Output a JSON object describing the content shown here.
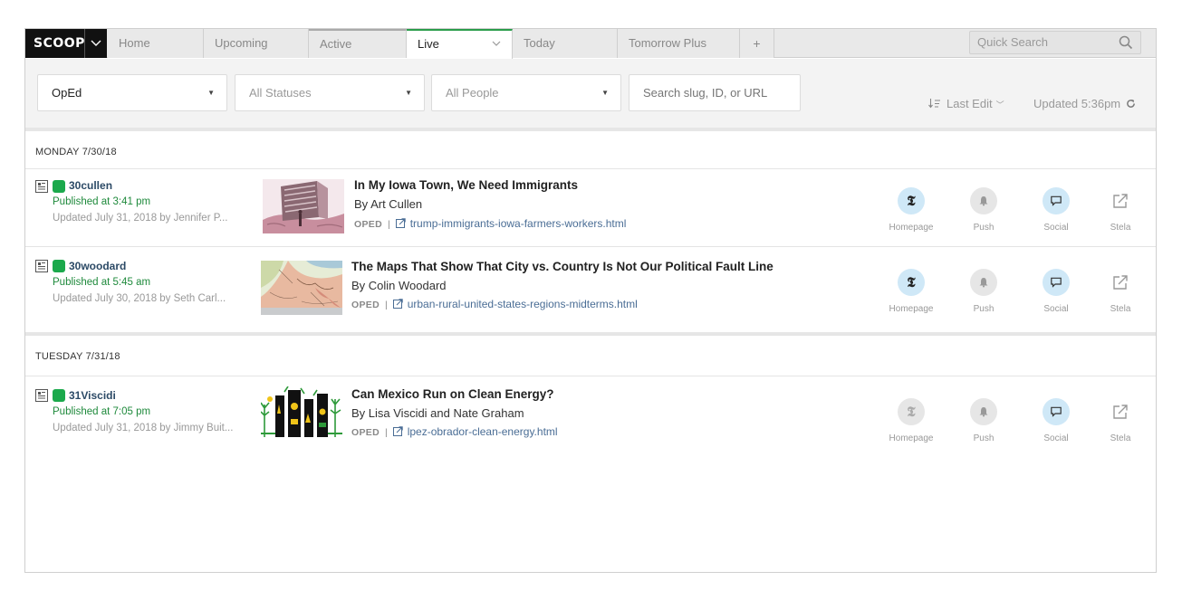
{
  "app": {
    "logo": "SCOOP"
  },
  "tabs": [
    {
      "label": "Home"
    },
    {
      "label": "Upcoming"
    },
    {
      "label": "Active"
    },
    {
      "label": "Live"
    },
    {
      "label": "Today"
    },
    {
      "label": "Tomorrow Plus"
    },
    {
      "label": "+"
    }
  ],
  "search": {
    "placeholder": "Quick Search"
  },
  "filters": {
    "desk": "OpEd",
    "status": "All Statuses",
    "people": "All People",
    "search_placeholder": "Search slug, ID, or URL",
    "sort_label": "Last Edit",
    "updated": "Updated 5:36pm"
  },
  "sections": [
    {
      "day": "MONDAY 7/30/18",
      "rows": [
        {
          "slug": "30cullen",
          "published": "Published at 3:41 pm",
          "updated": "Updated July 31, 2018 by Jennifer P...",
          "headline": "In My Iowa Town, We Need Immigrants",
          "byline": "By Art Cullen",
          "desk": "OPED",
          "url": "trump-immigrants-iowa-farmers-workers.html",
          "homepage_active": true
        },
        {
          "slug": "30woodard",
          "published": "Published at 5:45 am",
          "updated": "Updated July 30, 2018 by Seth Carl...",
          "headline": "The Maps That Show That City vs. Country Is Not Our Political Fault Line",
          "byline": "By Colin Woodard",
          "desk": "OPED",
          "url": "urban-rural-united-states-regions-midterms.html",
          "homepage_active": true
        }
      ]
    },
    {
      "day": "TUESDAY 7/31/18",
      "rows": [
        {
          "slug": "31Viscidi",
          "published": "Published at 7:05 pm",
          "updated": "Updated July 31, 2018 by Jimmy Buit...",
          "headline": "Can Mexico Run on Clean Energy?",
          "byline": "By Lisa Viscidi and Nate Graham",
          "desk": "OPED",
          "url": "lpez-obrador-clean-energy.html",
          "homepage_active": false
        }
      ]
    }
  ],
  "actions": {
    "homepage": "Homepage",
    "push": "Push",
    "social": "Social",
    "stela": "Stela"
  },
  "colors": {
    "live_accent": "#2a9d4b",
    "published": "#1f8a3c",
    "status_dot": "#1ba94c",
    "slug": "#2c4a66",
    "link": "#4a6d95",
    "active_circle": "#cfe8f7"
  }
}
